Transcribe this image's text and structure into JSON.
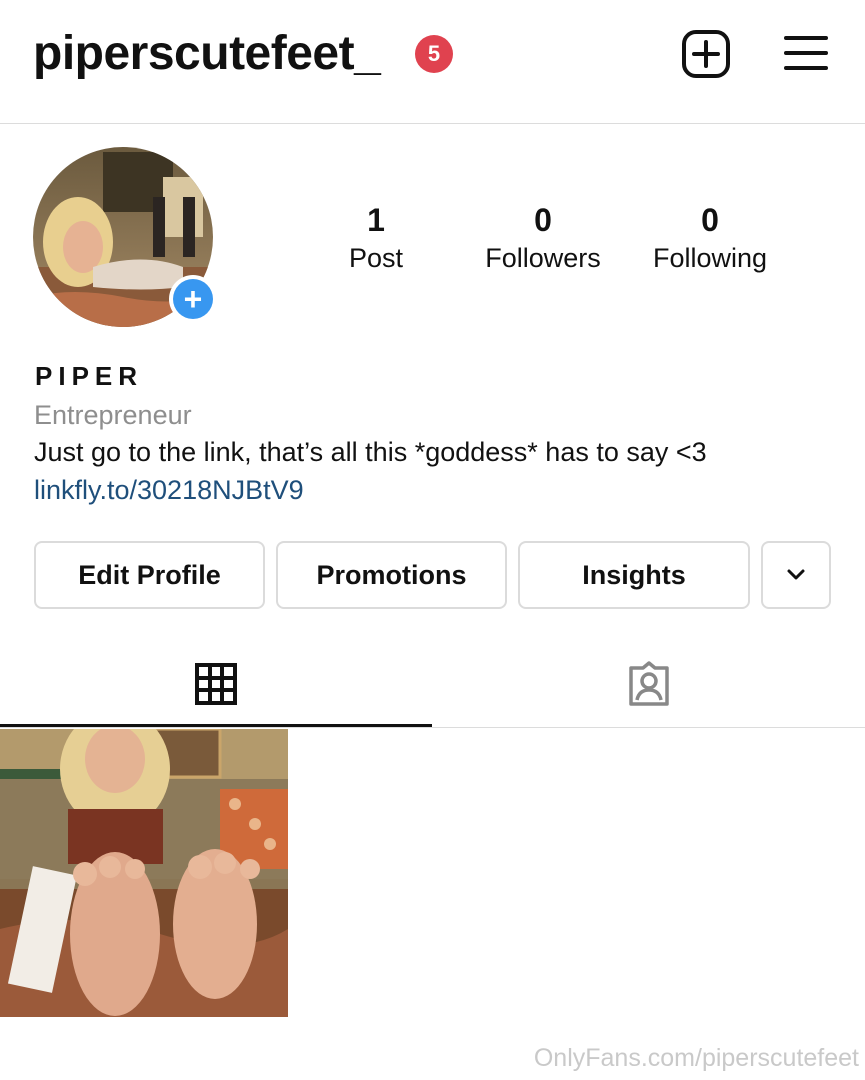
{
  "header": {
    "username": "piperscutefeet_",
    "notification_count": "5",
    "new_post_icon": "plus-square-icon",
    "menu_icon": "hamburger-menu-icon"
  },
  "profile": {
    "avatar_icon": "profile-photo",
    "avatar_add_symbol": "+",
    "stats": [
      {
        "value": "1",
        "label": "Post"
      },
      {
        "value": "0",
        "label": "Followers"
      },
      {
        "value": "0",
        "label": "Following"
      }
    ],
    "display_name": "PIPER",
    "category": "Entrepreneur",
    "bio": "Just go to the link, that’s all this *goddess* has to say <3",
    "link": "linkfly.to/30218NJBtV9"
  },
  "actions": {
    "edit_profile": "Edit Profile",
    "promotions": "Promotions",
    "insights": "Insights",
    "more_icon": "chevron-down-icon"
  },
  "tabs": {
    "grid_icon": "grid-icon",
    "tagged_icon": "tagged-person-icon"
  },
  "posts": [
    {
      "icon": "post-thumbnail"
    }
  ],
  "watermark": "OnlyFans.com/piperscutefeet",
  "colors": {
    "badge": "#e0424f",
    "accent_blue": "#3897f0",
    "link": "#1f4f7b",
    "muted_text": "#8e8e8e",
    "border": "#dbdbdb"
  }
}
